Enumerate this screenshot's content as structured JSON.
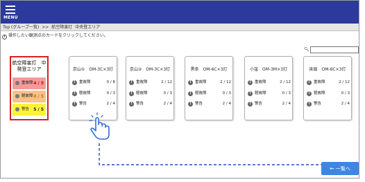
{
  "header": {
    "menu_label": "MENU",
    "bg_color": "#2b3a9b"
  },
  "breadcrumb": {
    "items": [
      "Top (グループ一覧)",
      ">>",
      "航空障害灯",
      "中央登エリア"
    ]
  },
  "instruction": {
    "text": "操作したい観測点のカードをクリックしてください。"
  },
  "search": {
    "value": "",
    "icon": "search-icon"
  },
  "area_panel": {
    "title_line1": "航空障害灯　中",
    "title_line2": "発登エリア",
    "border_color": "#d91f1f",
    "rows": [
      {
        "label": "重故障",
        "value": "4 / 5",
        "color": "#f59a9a"
      },
      {
        "label": "軽故障",
        "value": "0 / 5",
        "color": "#f7c28c"
      },
      {
        "label": "警告",
        "value": "5 / 5",
        "color": "#fff23a"
      }
    ]
  },
  "stations": [
    {
      "title": "京山①　OM-3C×3灯",
      "rows": [
        {
          "label": "重故障",
          "value": "0 / 8"
        },
        {
          "label": "軽故障",
          "value": "0 / 3"
        },
        {
          "label": "警告",
          "value": "2 / 4"
        }
      ]
    },
    {
      "title": "京山②　OM-3C×3灯",
      "rows": [
        {
          "label": "重故障",
          "value": "2 / 12"
        },
        {
          "label": "軽故障",
          "value": "0 / 3"
        },
        {
          "label": "警告",
          "value": "2 / 4"
        }
      ]
    },
    {
      "title": "黒条　OM-6C×3灯",
      "rows": [
        {
          "label": "重故障",
          "value": "2 / 12"
        },
        {
          "label": "軽故障",
          "value": "0 / 3"
        },
        {
          "label": "警告",
          "value": "2 / 4"
        }
      ]
    },
    {
      "title": "小窪　OM-3M×3灯",
      "rows": [
        {
          "label": "重故障",
          "value": "2 / 12"
        },
        {
          "label": "軽故障",
          "value": "0 / 3"
        },
        {
          "label": "警告",
          "value": "2 / 4"
        }
      ]
    },
    {
      "title": "床扇　OM-6C×3灯",
      "rows": [
        {
          "label": "重故障",
          "value": "2 / 12"
        },
        {
          "label": "軽故障",
          "value": "0 / 3"
        },
        {
          "label": "警告",
          "value": "2 / 4"
        }
      ]
    }
  ],
  "back_button": {
    "label": "一覧へ",
    "color": "#3d86e3"
  }
}
